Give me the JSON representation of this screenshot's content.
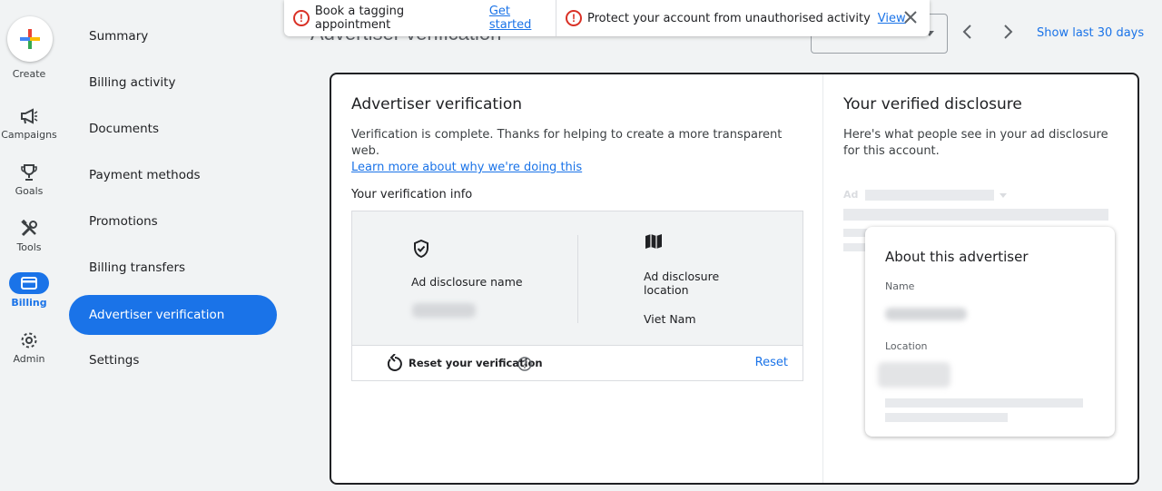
{
  "rail": {
    "create_label": "Create",
    "items": [
      {
        "label": "Campaigns",
        "icon": "megaphone-icon"
      },
      {
        "label": "Goals",
        "icon": "trophy-icon"
      },
      {
        "label": "Tools",
        "icon": "tools-icon"
      },
      {
        "label": "Billing",
        "icon": "billing-card-icon"
      },
      {
        "label": "Admin",
        "icon": "gear-icon"
      }
    ]
  },
  "subnav": {
    "items": [
      {
        "label": "Summary"
      },
      {
        "label": "Billing activity"
      },
      {
        "label": "Documents"
      },
      {
        "label": "Payment methods"
      },
      {
        "label": "Promotions"
      },
      {
        "label": "Billing transfers"
      },
      {
        "label": "Advertiser verification"
      },
      {
        "label": "Settings"
      }
    ],
    "active_index": 6
  },
  "header": {
    "title": "Advertiser verification",
    "date_range_label": "Show last 30 days"
  },
  "notifications": [
    {
      "text": "Book a tagging appointment",
      "link": "Get started"
    },
    {
      "text": "Protect your account from unauthorised activity",
      "link": "View"
    }
  ],
  "verification": {
    "title": "Advertiser verification",
    "description": "Verification is complete. Thanks for helping to create a more transparent web.",
    "learn_more": "Learn more about why we're doing this",
    "info_title": "Your verification info",
    "name_label": "Ad disclosure name",
    "location_label": "Ad disclosure location",
    "location_value": "Viet Nam",
    "reset_label": "Reset your verification",
    "reset_button": "Reset"
  },
  "disclosure": {
    "title": "Your verified disclosure",
    "description": "Here's what people see in your ad disclosure for this account.",
    "ad_badge": "Ad",
    "card_title": "About this advertiser",
    "name_label": "Name",
    "location_label": "Location"
  },
  "colors": {
    "accent": "#1a73e8",
    "alert": "#d93025",
    "background": "#f1f3f4"
  }
}
